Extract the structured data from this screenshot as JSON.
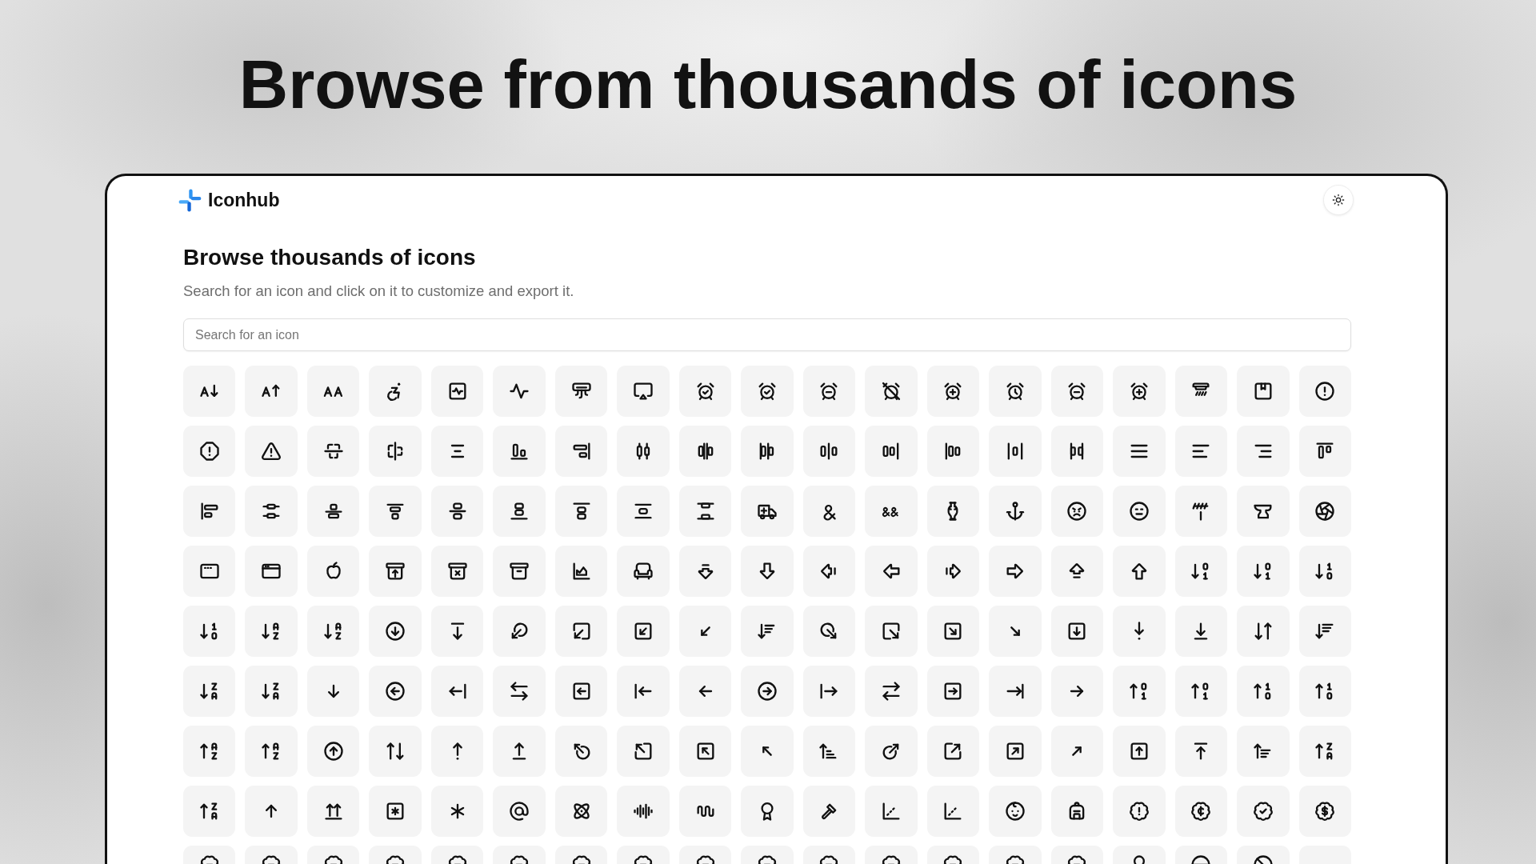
{
  "headline": "Browse from thousands of icons",
  "app": {
    "brand": "Iconhub",
    "title": "Browse thousands of icons",
    "subtitle": "Search for an icon and click on it to customize and export it.",
    "search": {
      "placeholder": "Search for an icon"
    }
  }
}
